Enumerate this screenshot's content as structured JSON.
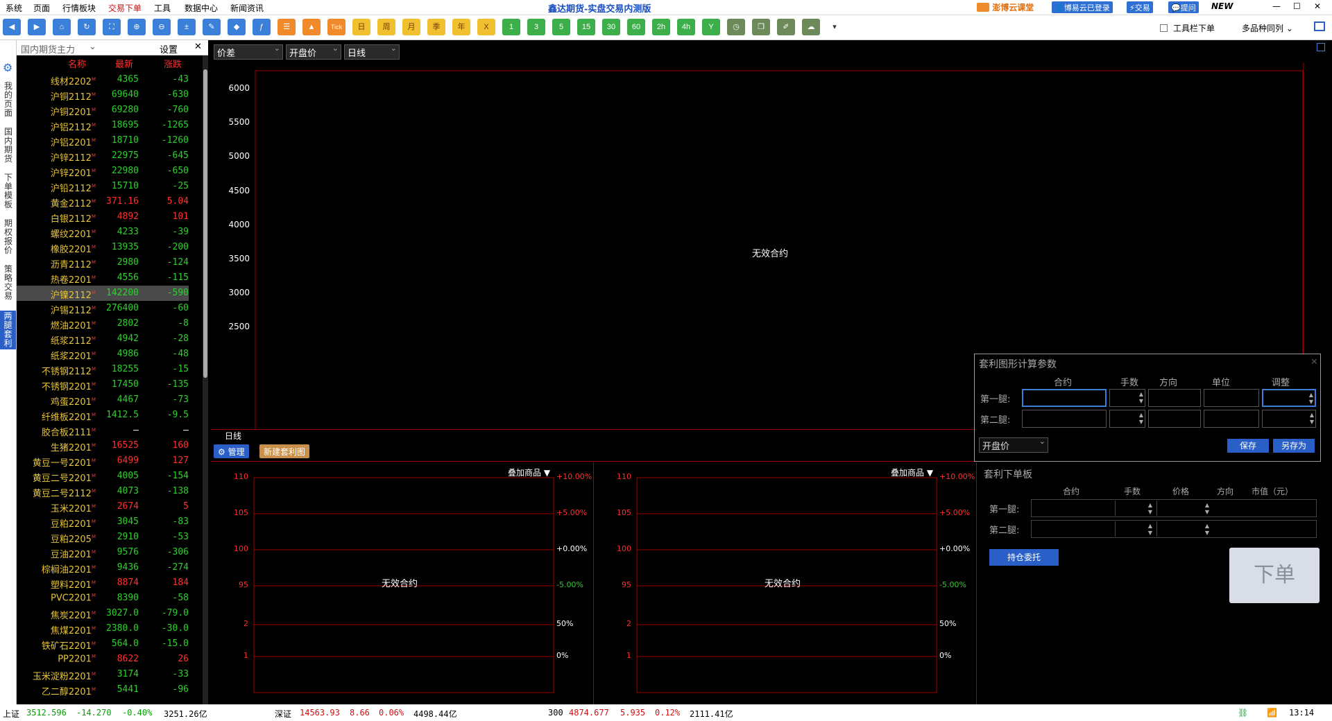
{
  "menu": {
    "items": [
      "系统",
      "页面",
      "行情板块",
      "交易下单",
      "工具",
      "数据中心",
      "新闻资讯"
    ],
    "title": "鑫达期货-实盘交易内测版",
    "cloud": "澎博云课堂",
    "login": "博易云已登录",
    "trade": "交易",
    "ask": "提问",
    "new": "NEW"
  },
  "toolbar": {
    "periods": [
      "Tick",
      "日",
      "周",
      "月",
      "季",
      "年",
      "X",
      "1",
      "3",
      "5",
      "15",
      "30",
      "60",
      "2h",
      "4h",
      "Y"
    ],
    "toolbar_order_label": "工具栏下单",
    "multi_label": "多品种同列"
  },
  "sidebar_tabs": [
    "我的页面",
    "国内期货",
    "下单模板",
    "期权报价",
    "策略交易",
    "两腿套利"
  ],
  "panel": {
    "title": "国内期货主力",
    "settings": "设置"
  },
  "watchlist": {
    "headers": [
      "名称",
      "最新",
      "涨跌"
    ],
    "rows": [
      {
        "name": "线材2202",
        "price": "4365",
        "change": "-43",
        "color": "green"
      },
      {
        "name": "沪铜2112",
        "price": "69640",
        "change": "-630",
        "color": "green"
      },
      {
        "name": "沪铜2201",
        "price": "69280",
        "change": "-760",
        "color": "green"
      },
      {
        "name": "沪铝2112",
        "price": "18695",
        "change": "-1265",
        "color": "green"
      },
      {
        "name": "沪铝2201",
        "price": "18710",
        "change": "-1260",
        "color": "green"
      },
      {
        "name": "沪锌2112",
        "price": "22975",
        "change": "-645",
        "color": "green"
      },
      {
        "name": "沪锌2201",
        "price": "22980",
        "change": "-650",
        "color": "green"
      },
      {
        "name": "沪铅2112",
        "price": "15710",
        "change": "-25",
        "color": "green"
      },
      {
        "name": "黄金2112",
        "price": "371.16",
        "change": "5.04",
        "color": "red"
      },
      {
        "name": "白银2112",
        "price": "4892",
        "change": "101",
        "color": "red"
      },
      {
        "name": "螺纹2201",
        "price": "4233",
        "change": "-39",
        "color": "green"
      },
      {
        "name": "橡胶2201",
        "price": "13935",
        "change": "-200",
        "color": "green"
      },
      {
        "name": "沥青2112",
        "price": "2980",
        "change": "-124",
        "color": "green"
      },
      {
        "name": "热卷2201",
        "price": "4556",
        "change": "-115",
        "color": "green"
      },
      {
        "name": "沪镍2112",
        "price": "142200",
        "change": "-590",
        "color": "green"
      },
      {
        "name": "沪锡2112",
        "price": "276400",
        "change": "-60",
        "color": "green"
      },
      {
        "name": "燃油2201",
        "price": "2802",
        "change": "-8",
        "color": "green"
      },
      {
        "name": "纸浆2112",
        "price": "4942",
        "change": "-28",
        "color": "green"
      },
      {
        "name": "纸浆2201",
        "price": "4986",
        "change": "-48",
        "color": "green"
      },
      {
        "name": "不锈钢2112",
        "price": "18255",
        "change": "-15",
        "color": "green"
      },
      {
        "name": "不锈钢2201",
        "price": "17450",
        "change": "-135",
        "color": "green"
      },
      {
        "name": "鸡蛋2201",
        "price": "4467",
        "change": "-73",
        "color": "green"
      },
      {
        "name": "纤维板2201",
        "price": "1412.5",
        "change": "-9.5",
        "color": "green"
      },
      {
        "name": "胶合板2111",
        "price": "–",
        "change": "–",
        "color": "white"
      },
      {
        "name": "生猪2201",
        "price": "16525",
        "change": "160",
        "color": "red"
      },
      {
        "name": "黄豆一号2201",
        "price": "6499",
        "change": "127",
        "color": "red"
      },
      {
        "name": "黄豆二号2201",
        "price": "4005",
        "change": "-154",
        "color": "green"
      },
      {
        "name": "黄豆二号2112",
        "price": "4073",
        "change": "-138",
        "color": "green"
      },
      {
        "name": "玉米2201",
        "price": "2674",
        "change": "5",
        "color": "red"
      },
      {
        "name": "豆粕2201",
        "price": "3045",
        "change": "-83",
        "color": "green"
      },
      {
        "name": "豆粕2205",
        "price": "2910",
        "change": "-53",
        "color": "green"
      },
      {
        "name": "豆油2201",
        "price": "9576",
        "change": "-306",
        "color": "green"
      },
      {
        "name": "棕榈油2201",
        "price": "9436",
        "change": "-274",
        "color": "green"
      },
      {
        "name": "塑料2201",
        "price": "8874",
        "change": "184",
        "color": "red"
      },
      {
        "name": "PVC2201",
        "price": "8390",
        "change": "-58",
        "color": "green"
      },
      {
        "name": "焦炭2201",
        "price": "3027.0",
        "change": "-79.0",
        "color": "green"
      },
      {
        "name": "焦煤2201",
        "price": "2380.0",
        "change": "-30.0",
        "color": "green"
      },
      {
        "name": "铁矿石2201",
        "price": "564.0",
        "change": "-15.0",
        "color": "green"
      },
      {
        "name": "PP2201",
        "price": "8622",
        "change": "26",
        "color": "red"
      },
      {
        "name": "玉米淀粉2201",
        "price": "3174",
        "change": "-33",
        "color": "green"
      },
      {
        "name": "乙二醇2201",
        "price": "5441",
        "change": "-96",
        "color": "green"
      }
    ],
    "selected_index": 14
  },
  "chart_controls": {
    "spread": "价差",
    "price_type": "开盘价",
    "period": "日线"
  },
  "main_chart": {
    "y_ticks": [
      "6000",
      "5500",
      "5000",
      "4500",
      "4000",
      "3500",
      "3000",
      "2500"
    ],
    "no_data": "无效合约",
    "tab_label": "日线"
  },
  "actions": {
    "manage": "管理",
    "new_chart": "新建套利图"
  },
  "sub_charts": [
    {
      "overlay": "叠加商品",
      "left_ticks": [
        "110",
        "105",
        "100",
        "95",
        "2",
        "1"
      ],
      "right_ticks": [
        "+10.00%",
        "+5.00%",
        "+0.00%",
        "-5.00%",
        "50%",
        "0%"
      ],
      "no_data": "无效合约"
    },
    {
      "overlay": "叠加商品",
      "left_ticks": [
        "110",
        "105",
        "100",
        "95",
        "2",
        "1"
      ],
      "right_ticks": [
        "+10.00%",
        "+5.00%",
        "+0.00%",
        "-5.00%",
        "50%",
        "0%"
      ],
      "no_data": "无效合约"
    }
  ],
  "params_dialog": {
    "title": "套利图形计算参数",
    "headers": [
      "合约",
      "手数",
      "方向",
      "单位",
      "调整"
    ],
    "leg1": "第一腿:",
    "leg2": "第二腿:",
    "price_select": "开盘价",
    "save": "保存",
    "save_as": "另存为"
  },
  "order_panel": {
    "title": "套利下单板",
    "headers": [
      "合约",
      "手数",
      "价格",
      "方向",
      "市值（元）"
    ],
    "leg1": "第一腿:",
    "leg2": "第二腿:",
    "close_btn": "持仓委托",
    "order_btn": "下单"
  },
  "statusbar": {
    "sh_label": "上证",
    "sh_index": "3512.596",
    "sh_chg": "-14.270",
    "sh_pct": "-0.40%",
    "sh_amount": "3251.26亿",
    "sz_label": "深证",
    "sz_index": "14563.93",
    "sz_chg": "8.66",
    "sz_pct": "0.06%",
    "sz_amount": "4498.44亿",
    "hs_label": "300",
    "hs_index": "4874.677",
    "hs_chg": "5.935",
    "hs_pct": "0.12%",
    "hs_amount": "2111.41亿",
    "time": "13:14"
  },
  "colors": {
    "up": "#ff3030",
    "down": "#30d030",
    "grid": "#a00000",
    "name": "#e8c438"
  }
}
